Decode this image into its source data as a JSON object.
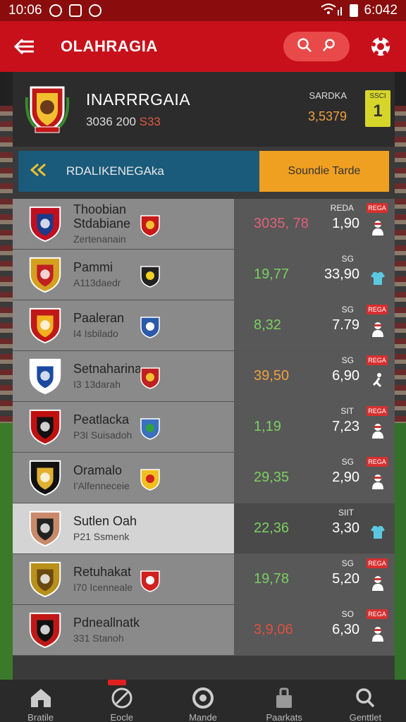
{
  "status_bar": {
    "time": "10:06",
    "right_time": "6:042"
  },
  "app_bar": {
    "title": "OLAHRAGIA"
  },
  "match_header": {
    "title": "INARRRGAIA",
    "sub_prefix": "3036 200",
    "sub_highlight": "S33",
    "right_label": "SARDKA",
    "right_value": "3,5379",
    "badge_label": "SSCI",
    "badge_value": "1"
  },
  "toggle": {
    "left_label": "RDALIKENEGAkа",
    "right_label": "Soundie Tarde"
  },
  "rows": [
    {
      "name": "Thoobian",
      "name2": "Stdabiane",
      "sub": "Zertenanain",
      "odd1": "3035, 78",
      "odd1_color": "#e0607a",
      "odd2": "1,90",
      "label": "REDA",
      "tag": "REGA",
      "style": "dark",
      "crest_colors": [
        "#c01020",
        "#1a3a8a"
      ],
      "mini_colors": [
        "#c81818",
        "#f0c030"
      ],
      "icon": "person-icon",
      "icon_color": "#ffffff"
    },
    {
      "name": "Pammi",
      "name2": "",
      "sub": "A113daedr",
      "odd1": "19,77",
      "odd1_color": "#7ad060",
      "odd2": "33,90",
      "label": "SG",
      "tag": "",
      "style": "dark",
      "crest_colors": [
        "#d4a020",
        "#c02020"
      ],
      "mini_colors": [
        "#222222",
        "#f0d020"
      ],
      "icon": "shirt-icon",
      "icon_color": "#5ac8e0"
    },
    {
      "name": "Paaleran",
      "name2": "",
      "sub": "I4 Isbilado",
      "odd1": "8,32",
      "odd1_color": "#7ad060",
      "odd2": "7.79",
      "label": "SG",
      "tag": "REGA",
      "style": "dark",
      "crest_colors": [
        "#c01818",
        "#f0b020"
      ],
      "mini_colors": [
        "#2a5aa8",
        "#ffffff"
      ],
      "icon": "person-icon",
      "icon_color": "#ffffff"
    },
    {
      "name": "Setnaharina",
      "name2": "",
      "sub": "I3 13darah",
      "odd1": "39,50",
      "odd1_color": "#f0a040",
      "odd2": "6,90",
      "label": "SG",
      "tag": "REGA",
      "style": "dark",
      "crest_colors": [
        "#ffffff",
        "#1a4aa0"
      ],
      "mini_colors": [
        "#c02020",
        "#f0c030"
      ],
      "icon": "kick-icon",
      "icon_color": "#ffffff"
    },
    {
      "name": "Peatlacka",
      "name2": "",
      "sub": "P3I Suisadoh",
      "odd1": "1,19",
      "odd1_color": "#7ad060",
      "odd2": "7,23",
      "label": "SIT",
      "tag": "REGA",
      "style": "dark",
      "crest_colors": [
        "#c01010",
        "#111111"
      ],
      "mini_colors": [
        "#3a70c0",
        "#30a040"
      ],
      "icon": "person-icon",
      "icon_color": "#ffffff"
    },
    {
      "name": "Oramalo",
      "name2": "",
      "sub": "I'Alfenneceie",
      "odd1": "29,35",
      "odd1_color": "#7ad060",
      "odd2": "2,90",
      "label": "SG",
      "tag": "REGA",
      "style": "dark",
      "crest_colors": [
        "#111111",
        "#e0b030"
      ],
      "mini_colors": [
        "#f0c020",
        "#d02020"
      ],
      "icon": "person-icon",
      "icon_color": "#ffffff"
    },
    {
      "name": "Sutlen Oah",
      "name2": "",
      "sub": "P21 Ssmenk",
      "odd1": "22,36",
      "odd1_color": "#7ad060",
      "odd2": "3,30",
      "label": "SIIT",
      "tag": "",
      "style": "light",
      "crest_colors": [
        "#c88a6a",
        "#222222"
      ],
      "mini_colors": [
        "",
        ""
      ],
      "icon": "shirt-icon",
      "icon_color": "#5ac8e0"
    },
    {
      "name": "Retuhakat",
      "name2": "",
      "sub": "I70 Icenneale",
      "odd1": "19,78",
      "odd1_color": "#7ad060",
      "odd2": "5,20",
      "label": "SG",
      "tag": "REGA",
      "style": "dark",
      "crest_colors": [
        "#b8901a",
        "#6a4a10"
      ],
      "mini_colors": [
        "#d02020",
        "#ffffff"
      ],
      "icon": "person-icon",
      "icon_color": "#ffffff"
    },
    {
      "name": "Pdneallnatk",
      "name2": "",
      "sub": "331 Stanoh",
      "odd1": "3,9,06",
      "odd1_color": "#e05040",
      "odd2": "6,30",
      "label": "SO",
      "tag": "REGA",
      "style": "dark",
      "crest_colors": [
        "#c01818",
        "#111111"
      ],
      "mini_colors": [
        "",
        ""
      ],
      "icon": "person-icon",
      "icon_color": "#ffffff"
    }
  ],
  "bottom_nav": [
    {
      "label": "Bratile",
      "icon": "home-icon"
    },
    {
      "label": "Eocle",
      "icon": "ball-icon"
    },
    {
      "label": "Mande",
      "icon": "target-icon"
    },
    {
      "label": "Paarkats",
      "icon": "bag-icon"
    },
    {
      "label": "Genttlet",
      "icon": "search-icon"
    }
  ],
  "colors": {
    "brand_red": "#c8101a",
    "accent_orange": "#f0a020",
    "teal": "#1a5a7a",
    "positive": "#7ad060"
  }
}
